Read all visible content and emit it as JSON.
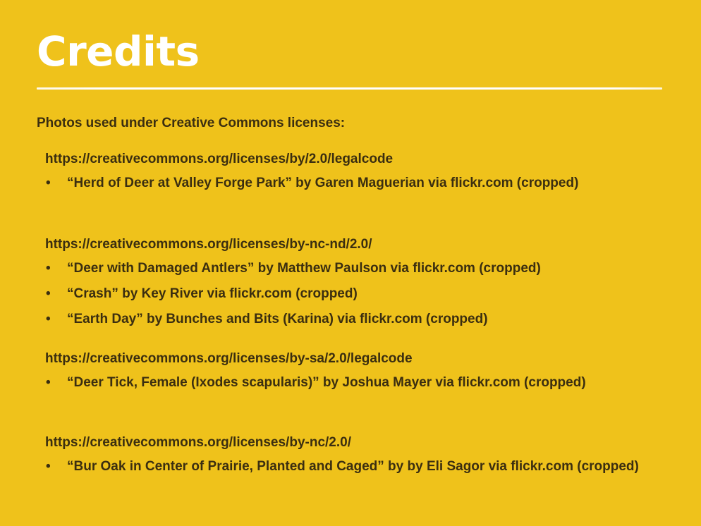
{
  "slide": {
    "title": "Credits",
    "intro": "Photos used under Creative Commons licenses:",
    "bullet_glyph": "•",
    "groups": [
      {
        "url": "https://creativecommons.org/licenses/by/2.0/legalcode",
        "items": [
          "“Herd of Deer at Valley Forge Park” by Garen Maguerian via flickr.com (cropped)"
        ]
      },
      {
        "url": "https://creativecommons.org/licenses/by-nc-nd/2.0/",
        "items": [
          "“Deer with Damaged Antlers” by Matthew Paulson via flickr.com (cropped)",
          "“Crash” by Key River via flickr.com (cropped)",
          "“Earth Day” by Bunches and Bits (Karina) via flickr.com (cropped)"
        ]
      },
      {
        "url": "https://creativecommons.org/licenses/by-sa/2.0/legalcode",
        "items": [
          "“Deer Tick, Female (Ixodes scapularis)” by Joshua Mayer via flickr.com (cropped)"
        ]
      },
      {
        "url": "https://creativecommons.org/licenses/by-nc/2.0/",
        "items": [
          "“Bur Oak in Center of Prairie, Planted and Caged” by by Eli Sagor via flickr.com (cropped)"
        ]
      }
    ]
  },
  "colors": {
    "background": "#efc21b",
    "title": "#ffffff",
    "rule": "#ffffff",
    "body_text": "#3b2e10"
  }
}
